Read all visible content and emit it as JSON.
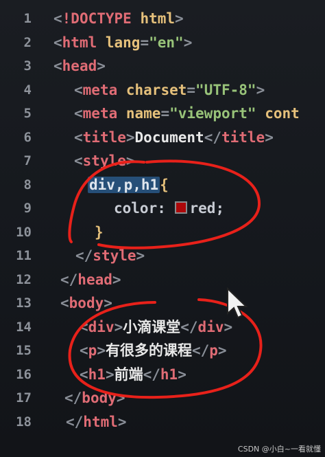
{
  "editor": {
    "lines": [
      {
        "n": "1",
        "parts": [
          [
            "punc",
            "<"
          ],
          [
            "tag",
            "!DOCTYPE "
          ],
          [
            "attr",
            "html"
          ],
          [
            "punc",
            ">"
          ]
        ],
        "indent": 78
      },
      {
        "n": "2",
        "parts": [
          [
            "punc",
            "<"
          ],
          [
            "tag",
            "html "
          ],
          [
            "attr",
            "lang"
          ],
          [
            "punc",
            "="
          ],
          [
            "str",
            "\"en\""
          ],
          [
            "punc",
            ">"
          ]
        ],
        "indent": 78
      },
      {
        "n": "3",
        "parts": [
          [
            "punc",
            "<"
          ],
          [
            "tag",
            "head"
          ],
          [
            "punc",
            ">"
          ]
        ],
        "indent": 78
      },
      {
        "n": "4",
        "parts": [
          [
            "punc",
            "<"
          ],
          [
            "tag",
            "meta "
          ],
          [
            "attr",
            "charset"
          ],
          [
            "punc",
            "="
          ],
          [
            "str",
            "\"UTF-8\""
          ],
          [
            "punc",
            ">"
          ]
        ],
        "indent": 108
      },
      {
        "n": "5",
        "parts": [
          [
            "punc",
            "<"
          ],
          [
            "tag",
            "meta "
          ],
          [
            "attr",
            "name"
          ],
          [
            "punc",
            "="
          ],
          [
            "str",
            "\"viewport\""
          ],
          [
            "punc",
            " "
          ],
          [
            "attr",
            "cont"
          ]
        ],
        "indent": 108
      },
      {
        "n": "6",
        "parts": [
          [
            "punc",
            "<"
          ],
          [
            "tag",
            "title"
          ],
          [
            "punc",
            ">"
          ],
          [
            "txt",
            "Document"
          ],
          [
            "punc",
            "</"
          ],
          [
            "tag",
            "title"
          ],
          [
            "punc",
            ">"
          ]
        ],
        "indent": 108
      },
      {
        "n": "7",
        "parts": [
          [
            "punc",
            "<"
          ],
          [
            "tag",
            "style"
          ],
          [
            "punc",
            ">"
          ]
        ],
        "indent": 108
      },
      {
        "n": "8",
        "parts": [
          [
            "sel",
            "div,p,h1"
          ],
          [
            "brace",
            "{"
          ]
        ],
        "indent": 128
      },
      {
        "n": "9",
        "parts": [
          [
            "kw",
            "color: "
          ],
          [
            "swatch",
            ""
          ],
          [
            "kw",
            "red;"
          ]
        ],
        "indent": 166
      },
      {
        "n": "10",
        "parts": [
          [
            "brace",
            "}"
          ]
        ],
        "indent": 138
      },
      {
        "n": "11",
        "parts": [
          [
            "punc",
            "</"
          ],
          [
            "tag",
            "style"
          ],
          [
            "punc",
            ">"
          ]
        ],
        "indent": 110
      },
      {
        "n": "12",
        "parts": [
          [
            "punc",
            "</"
          ],
          [
            "tag",
            "head"
          ],
          [
            "punc",
            ">"
          ]
        ],
        "indent": 88
      },
      {
        "n": "13",
        "parts": [
          [
            "punc",
            "<"
          ],
          [
            "tag",
            "body"
          ],
          [
            "punc",
            ">"
          ]
        ],
        "indent": 88
      },
      {
        "n": "14",
        "parts": [
          [
            "punc",
            "<"
          ],
          [
            "tag",
            "div"
          ],
          [
            "punc",
            ">"
          ],
          [
            "txt",
            "小滴课堂"
          ],
          [
            "punc",
            "</"
          ],
          [
            "tag",
            "div"
          ],
          [
            "punc",
            ">"
          ]
        ],
        "indent": 116
      },
      {
        "n": "15",
        "parts": [
          [
            "punc",
            "<"
          ],
          [
            "tag",
            "p"
          ],
          [
            "punc",
            ">"
          ],
          [
            "txt",
            "有很多的课程"
          ],
          [
            "punc",
            "</"
          ],
          [
            "tag",
            "p"
          ],
          [
            "punc",
            ">"
          ]
        ],
        "indent": 116
      },
      {
        "n": "16",
        "parts": [
          [
            "punc",
            "<"
          ],
          [
            "tag",
            "h1"
          ],
          [
            "punc",
            ">"
          ],
          [
            "txt",
            "前端"
          ],
          [
            "punc",
            "</"
          ],
          [
            "tag",
            "h1"
          ],
          [
            "punc",
            ">"
          ]
        ],
        "indent": 116
      },
      {
        "n": "17",
        "parts": [
          [
            "punc",
            "</"
          ],
          [
            "tag",
            "body"
          ],
          [
            "punc",
            ">"
          ]
        ],
        "indent": 94
      },
      {
        "n": "18",
        "parts": [
          [
            "punc",
            "</"
          ],
          [
            "tag",
            "html"
          ],
          [
            "punc",
            ">"
          ]
        ],
        "indent": 96
      }
    ]
  },
  "colors": {
    "annotation": "#e8211a",
    "selection": "#264f78",
    "background": "#15181d"
  },
  "watermark": {
    "text": "CSDN @小白~一看就懂"
  }
}
